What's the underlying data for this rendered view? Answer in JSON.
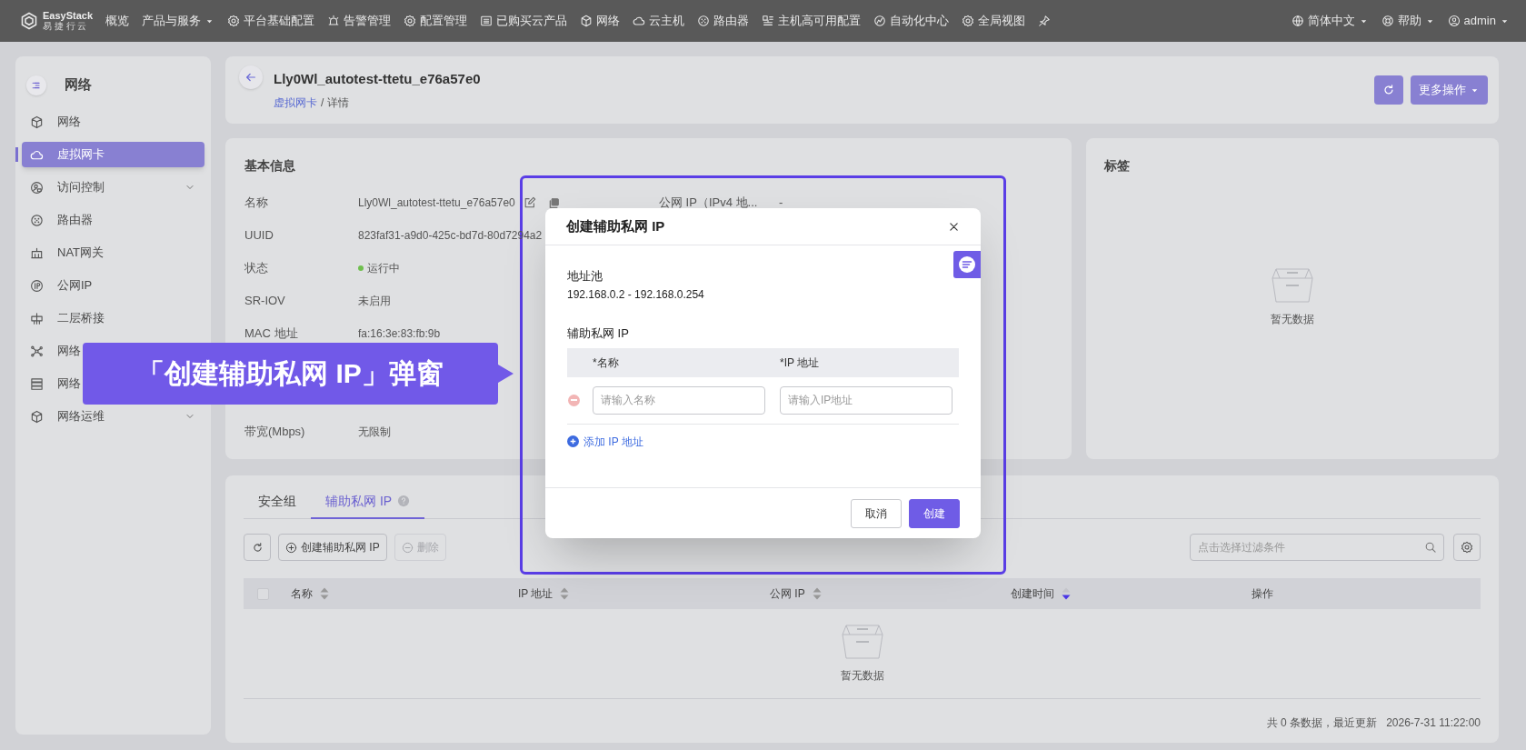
{
  "top_nav": {
    "logo": {
      "name": "EasyStack",
      "tagline": "易 捷 行 云"
    },
    "items": [
      {
        "label": "概览",
        "dropdown": false
      },
      {
        "label": "产品与服务",
        "dropdown": true
      },
      {
        "label": "平台基础配置",
        "dropdown": false
      },
      {
        "label": "告警管理",
        "dropdown": false
      },
      {
        "label": "配置管理",
        "dropdown": false
      },
      {
        "label": "已购买云产品",
        "dropdown": false
      },
      {
        "label": "网络",
        "dropdown": false
      },
      {
        "label": "云主机",
        "dropdown": false
      },
      {
        "label": "路由器",
        "dropdown": false
      },
      {
        "label": "主机高可用配置",
        "dropdown": false
      },
      {
        "label": "自动化中心",
        "dropdown": false
      },
      {
        "label": "全局视图",
        "dropdown": false
      }
    ],
    "right": [
      {
        "label": "简体中文",
        "dropdown": true
      },
      {
        "label": "帮助",
        "dropdown": true
      },
      {
        "label": "admin",
        "dropdown": true
      }
    ]
  },
  "sidebar": {
    "title": "网络",
    "items": [
      {
        "label": "网络",
        "selected": false,
        "expandable": false
      },
      {
        "label": "虚拟网卡",
        "selected": true,
        "expandable": false
      },
      {
        "label": "访问控制",
        "selected": false,
        "expandable": true
      },
      {
        "label": "路由器",
        "selected": false,
        "expandable": false
      },
      {
        "label": "NAT网关",
        "selected": false,
        "expandable": false
      },
      {
        "label": "公网IP",
        "selected": false,
        "expandable": false
      },
      {
        "label": "二层桥接",
        "selected": false,
        "expandable": false
      },
      {
        "label": "网络",
        "selected": false,
        "expandable": false
      },
      {
        "label": "网络",
        "selected": false,
        "expandable": false
      },
      {
        "label": "网络运维",
        "selected": false,
        "expandable": true
      }
    ]
  },
  "header": {
    "title": "Lly0Wl_autotest-ttetu_e76a57e0",
    "breadcrumb": [
      {
        "label": "虚拟网卡",
        "link": true
      },
      {
        "label": "详情",
        "link": false
      }
    ],
    "separator": "/",
    "more_button": "更多操作"
  },
  "basic_info": {
    "title": "基本信息",
    "rows": [
      {
        "label": "名称",
        "value": "Lly0Wl_autotest-ttetu_e76a57e0",
        "kind": "editable"
      },
      {
        "label": "UUID",
        "value": "823faf31-a9d0-425c-bd7d-80d7294a2",
        "kind": "text"
      },
      {
        "label": "状态",
        "value": "运行中",
        "kind": "status",
        "color": "#6fbf4e"
      },
      {
        "label": "SR-IOV",
        "value": "未启用",
        "kind": "text"
      },
      {
        "label": "MAC 地址",
        "value": "fa:16:3e:83:fb:9b",
        "kind": "text"
      },
      {
        "kind": "hidden"
      },
      {
        "kind": "hidden"
      },
      {
        "label": "带宽(Mbps)",
        "value": "无限制",
        "kind": "text"
      }
    ],
    "right_rows": [
      {
        "label": "公网 IP（IPv4 地...",
        "value": "-"
      }
    ]
  },
  "tags": {
    "title": "标签",
    "empty": "暂无数据"
  },
  "bottom": {
    "tabs": [
      {
        "label": "安全组",
        "selected": false,
        "help": false
      },
      {
        "label": "辅助私网 IP",
        "selected": true,
        "help": true
      }
    ],
    "toolbar": [
      {
        "kind": "refresh"
      },
      {
        "kind": "create",
        "label": "创建辅助私网 IP",
        "disabled": false
      },
      {
        "kind": "delete",
        "label": "删除",
        "disabled": true
      }
    ],
    "search": {
      "placeholder": "点击选择过滤条件"
    },
    "table": {
      "select_all": {
        "checked": false
      },
      "columns": [
        {
          "label": "名称",
          "sortable": true,
          "sorted": false
        },
        {
          "label": "IP 地址",
          "sortable": true,
          "sorted": false
        },
        {
          "label": "公网 IP",
          "sortable": true,
          "sorted": false
        },
        {
          "label": "创建时间",
          "sortable": true,
          "sorted": true
        },
        {
          "label": "操作",
          "sortable": false
        }
      ],
      "empty": "暂无数据"
    },
    "footer": {
      "count": "共 0 条数据，最近更新",
      "time": "2026-7-31 11:22:00"
    }
  },
  "modal": {
    "title": "创建辅助私网 IP",
    "pool_label": "地址池",
    "pool_value": "192.168.0.2 - 192.168.0.254",
    "section_label": "辅助私网 IP",
    "columns": [
      "*名称",
      "*IP 地址"
    ],
    "rows": [
      {
        "name_placeholder": "请输入名称",
        "ip_placeholder": "请输入IP地址"
      }
    ],
    "add_link": "添加 IP 地址",
    "buttons": [
      {
        "label": "取消",
        "kind": "default"
      },
      {
        "label": "创建",
        "kind": "primary"
      }
    ]
  },
  "annotation": {
    "callout": "「创建辅助私网 IP」弹窗"
  }
}
